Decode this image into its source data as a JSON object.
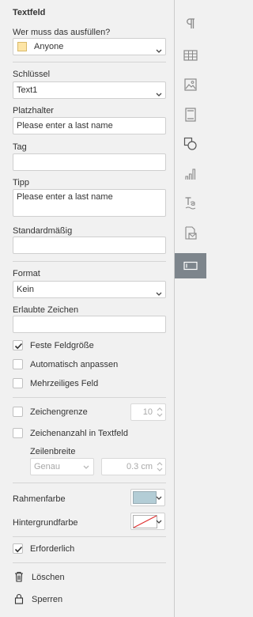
{
  "panel": {
    "title": "Textfeld",
    "who_label": "Wer muss das ausfüllen?",
    "who_value": "Anyone",
    "who_color": "#fde5a6",
    "key_label": "Schlüssel",
    "key_value": "Text1",
    "placeholder_label": "Platzhalter",
    "placeholder_value": "Please enter a last name",
    "tag_label": "Tag",
    "tag_value": "",
    "tip_label": "Tipp",
    "tip_value": "Please enter a last name",
    "default_label": "Standardmäßig",
    "default_value": "",
    "format_label": "Format",
    "format_value": "Kein",
    "allowed_label": "Erlaubte Zeichen",
    "allowed_value": "",
    "fixed_size": {
      "label": "Feste Feldgröße",
      "checked": true
    },
    "autofit": {
      "label": "Automatisch anpassen",
      "checked": false
    },
    "multiline": {
      "label": "Mehrzeiliges Feld",
      "checked": false
    },
    "char_limit": {
      "label": "Zeichengrenze",
      "value": "10",
      "checked": false
    },
    "char_count": {
      "label": "Zeichenanzahl in Textfeld",
      "checked": false
    },
    "cell_width_label": "Zeilenbreite",
    "cell_width_mode": "Genau",
    "cell_width_value": "0.3 cm",
    "border_color_label": "Rahmenfarbe",
    "border_color": "#b3cdd6",
    "bg_color_label": "Hintergrundfarbe",
    "required": {
      "label": "Erforderlich",
      "checked": true
    },
    "delete_label": "Löschen",
    "lock_label": "Sperren"
  },
  "rail": {
    "items": [
      "paragraph-icon",
      "table-icon",
      "image-icon",
      "header-footer-icon",
      "shape-icon",
      "chart-icon",
      "text-art-icon",
      "mail-merge-icon",
      "form-field-icon"
    ],
    "active_index": 8
  }
}
